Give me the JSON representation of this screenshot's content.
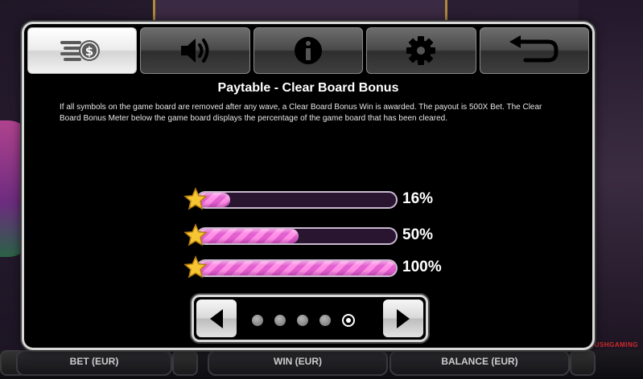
{
  "paytable": {
    "title": "Paytable - Clear Board Bonus",
    "description": "If all symbols on the game board are removed after any wave, a Clear Board Bonus Win is awarded.  The payout is 500X Bet.  The Clear Board Bonus Meter below the game board displays the percentage of the game board that has been cleared."
  },
  "tabs": [
    {
      "id": "paytable",
      "icon": "money-stack-icon",
      "active": true
    },
    {
      "id": "sound",
      "icon": "speaker-icon",
      "active": false
    },
    {
      "id": "info",
      "icon": "info-icon",
      "active": false
    },
    {
      "id": "settings",
      "icon": "gear-icon",
      "active": false
    },
    {
      "id": "back",
      "icon": "return-arrow-icon",
      "active": false
    }
  ],
  "meters": [
    {
      "label": "16%",
      "fill": 0.16
    },
    {
      "label": "50%",
      "fill": 0.5
    },
    {
      "label": "100%",
      "fill": 1.0
    }
  ],
  "pager": {
    "page_count": 5,
    "current_page": 5
  },
  "bottom_bar": {
    "bet_label": "BET (EUR)",
    "win_label": "WIN (EUR)",
    "balance_label": "BALANCE (EUR)"
  },
  "brand": {
    "prefix": "A",
    "name": "PUSHGAMING"
  },
  "colors": {
    "meter_fill": "#ff8fe6",
    "star": "#f7c531",
    "panel_border": "#d8d8d8"
  }
}
